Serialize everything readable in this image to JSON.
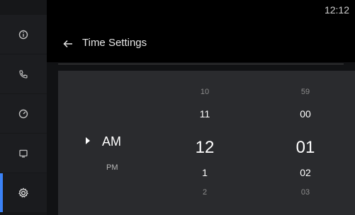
{
  "status": {
    "clock": "12:12"
  },
  "header": {
    "title": "Time Settings"
  },
  "sidebar": {
    "items": [
      {
        "icon": "info-icon"
      },
      {
        "icon": "phone-icon"
      },
      {
        "icon": "gauge-icon"
      },
      {
        "icon": "display-icon"
      },
      {
        "icon": "gear-icon",
        "active": true
      }
    ],
    "accent_color": "#3b82f6"
  },
  "picker": {
    "ampm": {
      "selected": "AM",
      "other": "PM"
    },
    "hours": {
      "prev2": "10",
      "prev1": "11",
      "selected": "12",
      "next1": "1",
      "next2": "2"
    },
    "minutes": {
      "prev2": "59",
      "prev1": "00",
      "selected": "01",
      "next1": "02",
      "next2": "03"
    }
  }
}
